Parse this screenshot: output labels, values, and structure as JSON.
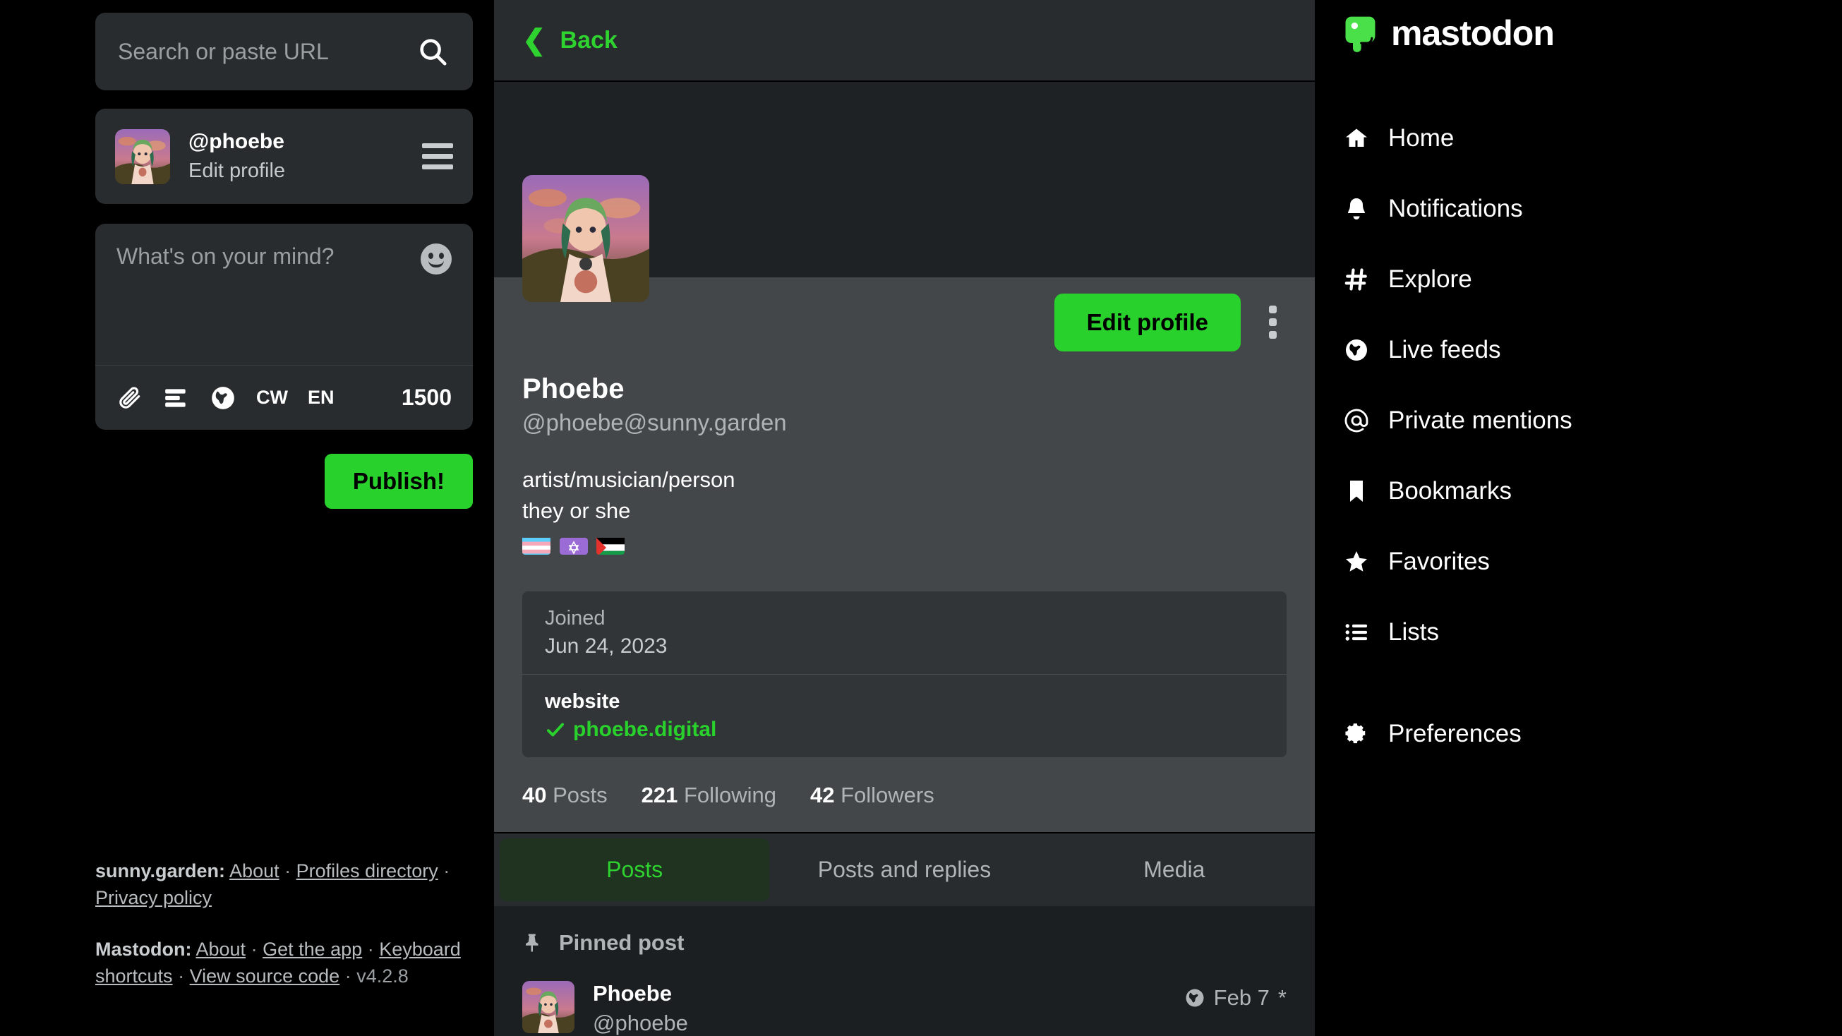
{
  "search": {
    "placeholder": "Search or paste URL",
    "value": "",
    "icon": "search-icon"
  },
  "account_card": {
    "handle": "@phoebe",
    "action": "Edit profile",
    "menu_icon": "hamburger-icon"
  },
  "composer": {
    "placeholder": "What's on your mind?",
    "value": "",
    "emoji_icon": "emoji-smiley-icon",
    "attach_icon": "paperclip-icon",
    "poll_icon": "poll-icon",
    "visibility_icon": "globe-icon",
    "cw_label": "CW",
    "language_label": "EN",
    "char_count": "1500",
    "publish_label": "Publish!"
  },
  "footer": {
    "instance_name": "sunny.garden:",
    "instance_links": [
      "About",
      "Profiles directory",
      "Privacy policy"
    ],
    "mastodon_name": "Mastodon:",
    "mastodon_links": [
      "About",
      "Get the app",
      "Keyboard shortcuts",
      "View source code"
    ],
    "version": "v4.2.8",
    "separator": "·"
  },
  "profile": {
    "back_label": "Back",
    "back_icon": "chevron-left-icon",
    "edit_profile_label": "Edit profile",
    "more_icon": "kebab-menu-icon",
    "display_name": "Phoebe",
    "acct": "@phoebe@sunny.garden",
    "bio_line1": "artist/musician/person",
    "bio_line2": "they or she",
    "bio_flags": "🏳️‍⚧️ ✡️ 🇵🇸",
    "fields": [
      {
        "name": "Joined",
        "value": "Jun 24, 2023",
        "verified": false,
        "bold_name": false
      },
      {
        "name": "website",
        "value": "phoebe.digital",
        "verified": true,
        "bold_name": true
      }
    ],
    "stats": [
      {
        "count": "40",
        "label": "Posts"
      },
      {
        "count": "221",
        "label": "Following"
      },
      {
        "count": "42",
        "label": "Followers"
      }
    ],
    "tabs": [
      {
        "label": "Posts",
        "active": true
      },
      {
        "label": "Posts and replies",
        "active": false
      },
      {
        "label": "Media",
        "active": false
      }
    ]
  },
  "timeline": {
    "pinned_label": "Pinned post",
    "pin_icon": "pin-icon",
    "post": {
      "author_name": "Phoebe",
      "author_handle": "@phoebe",
      "visibility_icon": "globe-icon",
      "timestamp": "Feb 7",
      "edited_mark": "*"
    }
  },
  "nav": {
    "brand": "mastodon",
    "items": [
      {
        "label": "Home",
        "icon": "home-icon"
      },
      {
        "label": "Notifications",
        "icon": "bell-icon"
      },
      {
        "label": "Explore",
        "icon": "hashtag-icon"
      },
      {
        "label": "Live feeds",
        "icon": "globe-icon"
      },
      {
        "label": "Private mentions",
        "icon": "at-icon"
      },
      {
        "label": "Bookmarks",
        "icon": "bookmark-icon"
      },
      {
        "label": "Favorites",
        "icon": "star-icon"
      },
      {
        "label": "Lists",
        "icon": "list-icon"
      },
      {
        "label": "Preferences",
        "icon": "gear-icon"
      }
    ]
  },
  "colors": {
    "accent_green": "#29d12c",
    "link_green": "#2fd32f",
    "page_bg": "#000000",
    "panel_bg": "#282c2e",
    "profile_bg": "#434749"
  }
}
